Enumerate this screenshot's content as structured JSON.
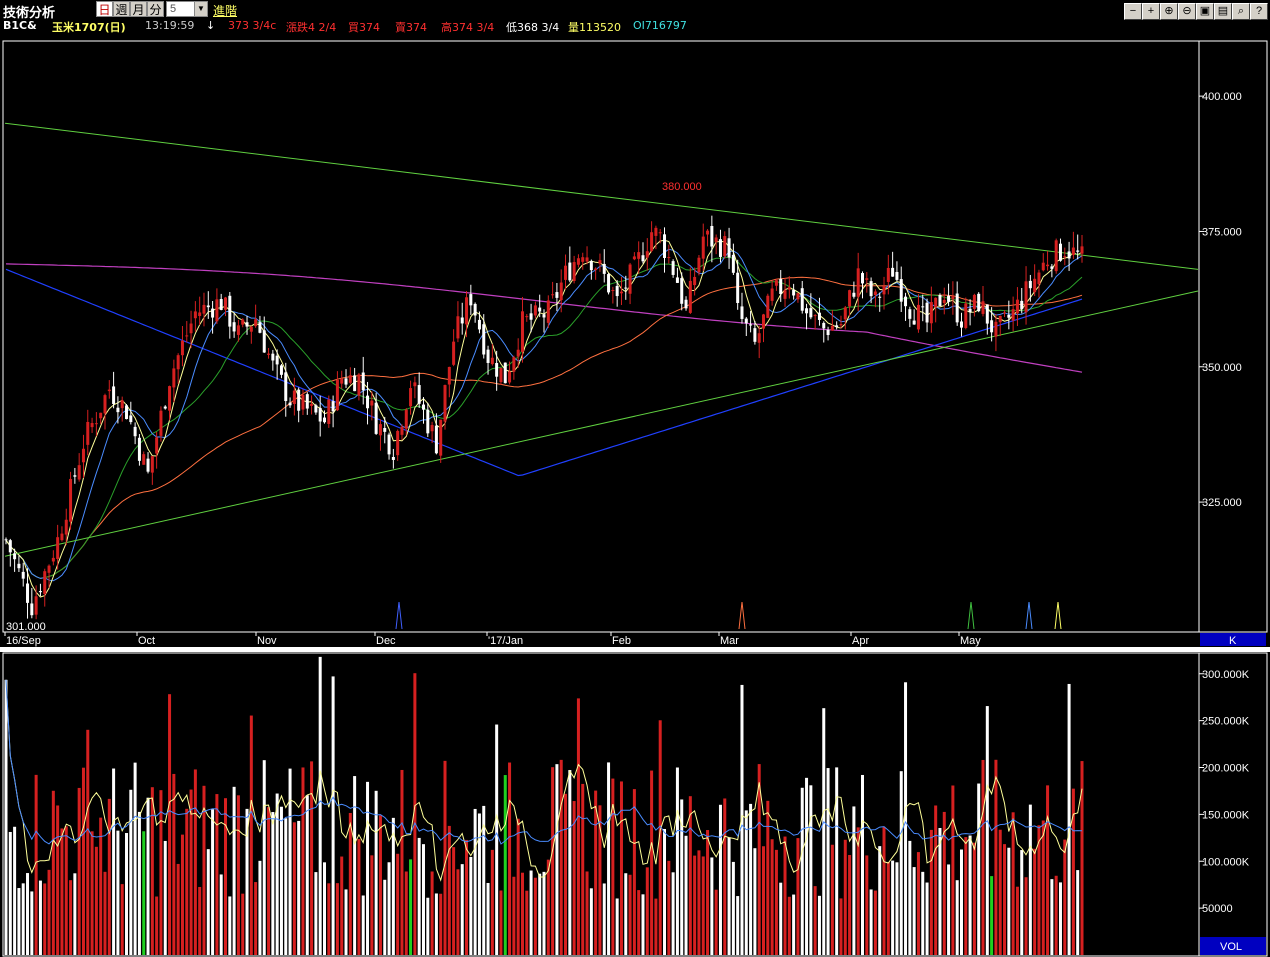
{
  "toolbar": {
    "title": "技術分析",
    "periods": [
      "日",
      "週",
      "月",
      "分"
    ],
    "active_period": "日",
    "interval_value": "5",
    "advanced_label": "進階",
    "buttons": [
      "minus-icon",
      "plus-icon",
      "zoom-in-icon",
      "zoom-out-icon",
      "restore-icon",
      "save-icon",
      "search-icon",
      "help-icon"
    ],
    "button_glyphs": [
      "−",
      "+",
      "⊕",
      "⊖",
      "▣",
      "▤",
      "⌕",
      "?"
    ]
  },
  "quote": {
    "symbol": "B1C&",
    "name": "玉米1707(日)",
    "time": "13:19:59",
    "arrow": "↓",
    "last": "373 3/4c",
    "change": "漲跌4 2/4",
    "bid": "買374",
    "ask": "賣374",
    "high": "高374 3/4",
    "low": "低368 3/4",
    "volume": "量113520",
    "oi": "OI716797"
  },
  "colors": {
    "up_candle": "#d62020",
    "down_candle": "#ffffff",
    "ma5": "#ffff99",
    "ma10": "#4a8cff",
    "ma20": "#2aa02a",
    "ma60": "#ff7040",
    "ma120": "#2040ff",
    "ma250": "#c040c0",
    "trendline": "#60d040",
    "axis_label_bg": "#0000c0"
  },
  "price_panel": {
    "y_ticks": [
      "400.000",
      "375.000",
      "350.000",
      "325.000"
    ],
    "x_labels": [
      "16/Sep",
      "Oct",
      "Nov",
      "Dec",
      "'17/Jan",
      "Feb",
      "Mar",
      "Apr",
      "May"
    ],
    "high_annotation": "380.000",
    "low_annotation": "301.000",
    "panel_tag": "K"
  },
  "volume_panel": {
    "y_ticks": [
      "300.000K",
      "250.000K",
      "200.000K",
      "150.000K",
      "100.000K",
      "50000"
    ],
    "panel_tag": "VOL"
  },
  "chart_data": {
    "type": "candlestick",
    "price_range": [
      301,
      410
    ],
    "volume_range": [
      0,
      320000
    ],
    "resistance_line": {
      "from": 395,
      "to": 368
    },
    "support_line": {
      "from": 315,
      "to": 364
    },
    "volume_peak": 318000
  }
}
